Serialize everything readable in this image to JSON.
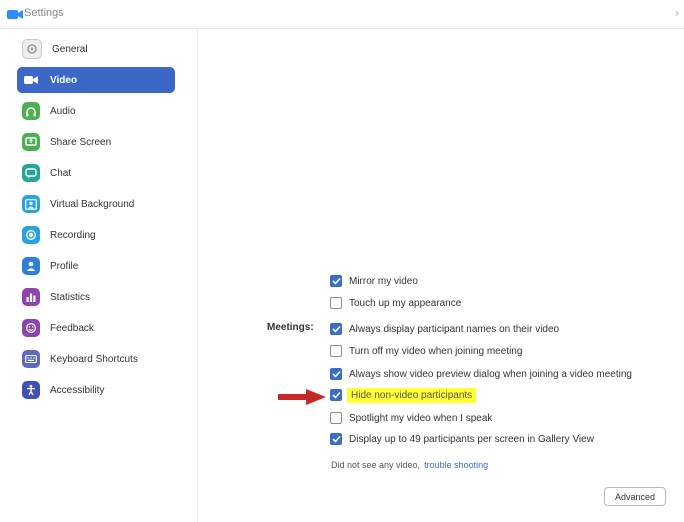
{
  "window": {
    "title": "Settings"
  },
  "sidebar": {
    "items": [
      {
        "label": "General",
        "icon": "gear-icon",
        "selected": false,
        "color": "#9e9e9e"
      },
      {
        "label": "Video",
        "icon": "video-camera-icon",
        "selected": true,
        "color": "#3b68c6"
      },
      {
        "label": "Audio",
        "icon": "headphones-icon",
        "selected": false,
        "color": "#4caf50"
      },
      {
        "label": "Share Screen",
        "icon": "share-screen-icon",
        "selected": false,
        "color": "#4caf50"
      },
      {
        "label": "Chat",
        "icon": "chat-bubble-icon",
        "selected": false,
        "color": "#26a69a"
      },
      {
        "label": "Virtual Background",
        "icon": "person-background-icon",
        "selected": false,
        "color": "#29a3e0"
      },
      {
        "label": "Recording",
        "icon": "record-icon",
        "selected": false,
        "color": "#29a3e0"
      },
      {
        "label": "Profile",
        "icon": "profile-icon",
        "selected": false,
        "color": "#2f7fd6"
      },
      {
        "label": "Statistics",
        "icon": "bar-chart-icon",
        "selected": false,
        "color": "#8e44ad"
      },
      {
        "label": "Feedback",
        "icon": "smiley-icon",
        "selected": false,
        "color": "#8e44ad"
      },
      {
        "label": "Keyboard Shortcuts",
        "icon": "keyboard-icon",
        "selected": false,
        "color": "#5c6bc0"
      },
      {
        "label": "Accessibility",
        "icon": "accessibility-icon",
        "selected": false,
        "color": "#3f51b5"
      }
    ]
  },
  "video": {
    "options_top": [
      {
        "label": "Mirror my video",
        "checked": true
      },
      {
        "label": "Touch up my appearance",
        "checked": false
      }
    ],
    "meetings_label": "Meetings:",
    "meetings_options": [
      {
        "label": "Always display participant names on their video",
        "checked": true
      },
      {
        "label": "Turn off my video when joining meeting",
        "checked": false
      },
      {
        "label": "Always show video preview dialog when joining a video meeting",
        "checked": true
      },
      {
        "label": "Hide non-video participants",
        "checked": true,
        "highlighted": true
      },
      {
        "label": "Spotlight my video when I speak",
        "checked": false
      },
      {
        "label": "Display up to 49 participants per screen in Gallery View",
        "checked": true
      }
    ],
    "help_text": "Did not see any video,",
    "help_link": "trouble shooting",
    "advanced_label": "Advanced"
  },
  "colors": {
    "accent": "#3b68c6",
    "highlight": "#ffff33",
    "arrow": "#c62828"
  }
}
